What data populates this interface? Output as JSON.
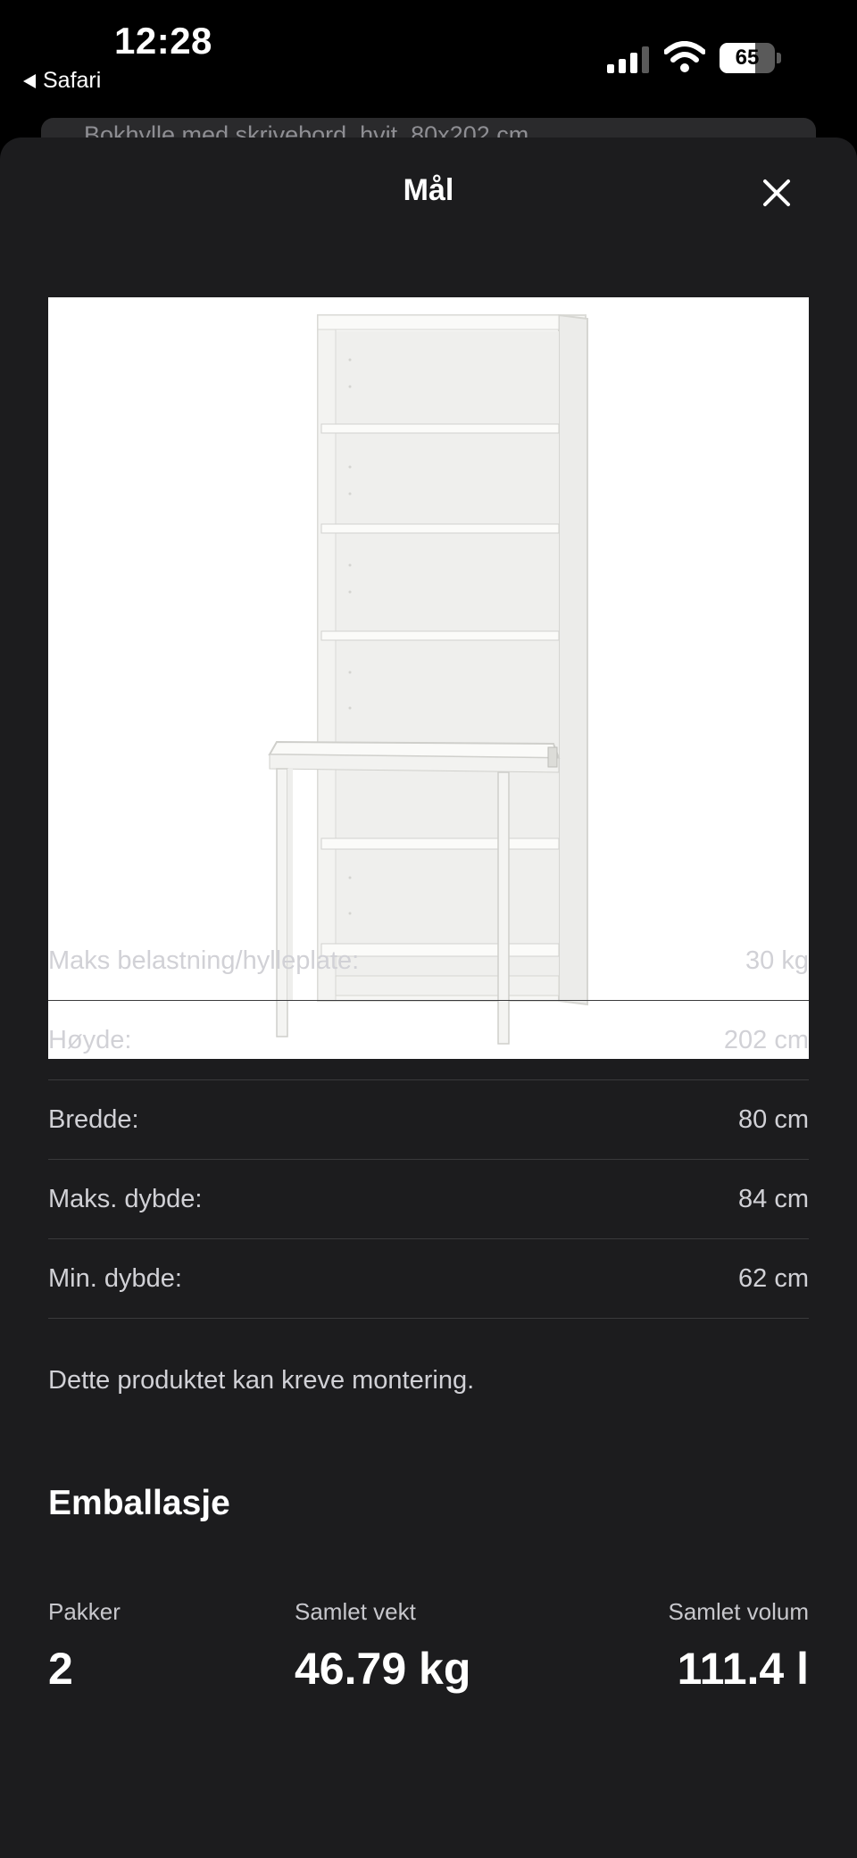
{
  "status_bar": {
    "time": "12:28",
    "back_app": "Safari",
    "battery_percent": "65",
    "battery_level": 0.65,
    "icons": [
      "cellular-signal-icon",
      "wifi-icon",
      "battery-icon"
    ]
  },
  "background_page": {
    "title_peek": "Bokhylle med skrivebord, hvit, 80x202 cm"
  },
  "sheet": {
    "title": "Mål",
    "close_icon": "close-icon"
  },
  "specs": [
    {
      "label": "Maks belastning/hylleplate:",
      "value": "30 kg"
    },
    {
      "label": "Høyde:",
      "value": "202 cm"
    },
    {
      "label": "Bredde:",
      "value": "80 cm"
    },
    {
      "label": "Maks. dybde:",
      "value": "84 cm"
    },
    {
      "label": "Min. dybde:",
      "value": "62 cm"
    }
  ],
  "assembly_note": "Dette produktet kan kreve montering.",
  "packaging": {
    "heading": "Emballasje",
    "packages_label": "Pakker",
    "packages_value": "2",
    "weight_label": "Samlet vekt",
    "weight_value": "46.79 kg",
    "volume_label": "Samlet volum",
    "volume_value": "111.4 l"
  },
  "colors": {
    "background": "#000000",
    "sheet": "#1c1c1e",
    "divider": "#3a3a3c",
    "text_primary": "#ffffff",
    "text_secondary": "#d1d1d6"
  }
}
